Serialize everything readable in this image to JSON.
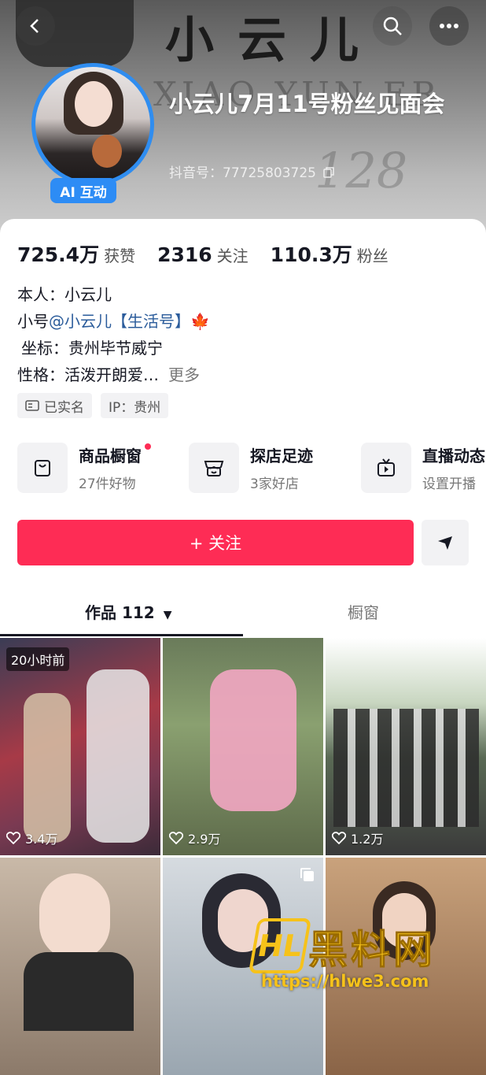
{
  "header": {
    "banner_text": "小云儿",
    "banner_sub": "XIAO YUN ER",
    "banner_num": "128",
    "title": "小云儿7月11号粉丝见面会",
    "douyin_id": "抖音号：77725803725",
    "ai_badge": "AI 互动",
    "back_icon": "back-arrow-icon",
    "search_icon": "search-icon",
    "more_icon": "more-dots-icon"
  },
  "stats": [
    {
      "num": "725.4万",
      "label": "获赞"
    },
    {
      "num": "2316",
      "label": "关注"
    },
    {
      "num": "110.3万",
      "label": "粉丝"
    }
  ],
  "bio": {
    "line1": "本人：小云儿",
    "line2_prefix": "小号",
    "line2_mention": "@小云儿【生活号】",
    "line2_emoji": "🍁",
    "line3": "坐标：贵州毕节威宁",
    "line4": "性格：活泼开朗爱…",
    "more": "更多"
  },
  "tags": [
    "已实名",
    "IP：贵州"
  ],
  "features": [
    {
      "title": "商品橱窗",
      "sub": "27件好物",
      "icon": "bag-icon"
    },
    {
      "title": "探店足迹",
      "sub": "3家好店",
      "icon": "store-icon"
    },
    {
      "title": "直播动态",
      "sub": "设置开播",
      "icon": "tv-icon"
    }
  ],
  "follow_label": "+ 关注",
  "tabs": [
    {
      "label": "作品 112"
    },
    {
      "label": "橱窗"
    }
  ],
  "videos": [
    {
      "likes": "3.4万",
      "badge": "20小时前"
    },
    {
      "likes": "2.9万"
    },
    {
      "likes": "1.2万"
    },
    {
      "likes": ""
    },
    {
      "likes": ""
    },
    {
      "likes": ""
    }
  ],
  "watermark": {
    "logo": "HL",
    "title": "黑料网",
    "url": "https://hlwe3.com"
  },
  "colors": {
    "accent": "#fe2c55",
    "ai_badge": "#2d8cf5",
    "mention": "#2b5c9b"
  }
}
